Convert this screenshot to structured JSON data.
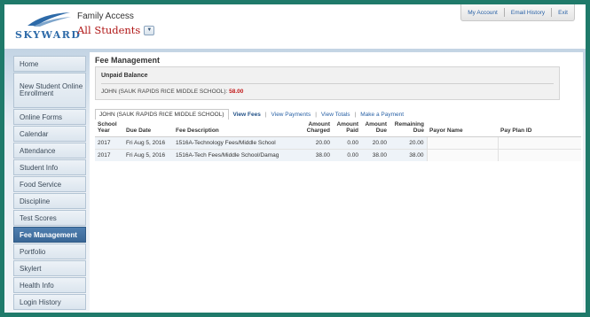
{
  "header": {
    "logo_text": "SKYWARD",
    "app_title": "Family Access",
    "student_selector": "All Students",
    "top_links": [
      "My Account",
      "Email History",
      "Exit"
    ]
  },
  "sidebar": {
    "items": [
      {
        "label": "Home"
      },
      {
        "label": "New Student Online Enrollment"
      },
      {
        "label": "Online Forms"
      },
      {
        "label": "Calendar"
      },
      {
        "label": "Attendance"
      },
      {
        "label": "Student Info"
      },
      {
        "label": "Food Service"
      },
      {
        "label": "Discipline"
      },
      {
        "label": "Test Scores"
      },
      {
        "label": "Fee Management",
        "active": true
      },
      {
        "label": "Portfolio"
      },
      {
        "label": "Skylert"
      },
      {
        "label": "Health Info"
      },
      {
        "label": "Login History"
      }
    ]
  },
  "main": {
    "title": "Fee Management",
    "unpaid": {
      "title": "Unpaid Balance",
      "student": "JOHN (SAUK RAPIDS RICE MIDDLE SCHOOL):",
      "amount": "58.00"
    },
    "tabs": {
      "current": "JOHN (SAUK RAPIDS RICE MIDDLE SCHOOL)",
      "links": [
        "View Fees",
        "View Payments",
        "View Totals",
        "Make a Payment"
      ]
    },
    "table": {
      "headers": [
        "School Year",
        "Due Date",
        "Fee Description",
        "Amount Charged",
        "Amount Paid",
        "Amount Due",
        "Remaining Due",
        "Payor Name",
        "Pay Plan ID"
      ],
      "rows": [
        [
          "2017",
          "Fri Aug 5, 2016",
          "1516A-Technology Fees/Middle School",
          "20.00",
          "0.00",
          "20.00",
          "20.00",
          "",
          ""
        ],
        [
          "2017",
          "Fri Aug 5, 2016",
          "1516A-Tech Fees/Middle School/Damag",
          "38.00",
          "0.00",
          "38.00",
          "38.00",
          "",
          ""
        ]
      ]
    }
  },
  "colors": {
    "accent_blue": "#2a62a6",
    "active_nav": "#3a6796",
    "balance_red": "#c21818",
    "student_red": "#b01717"
  }
}
